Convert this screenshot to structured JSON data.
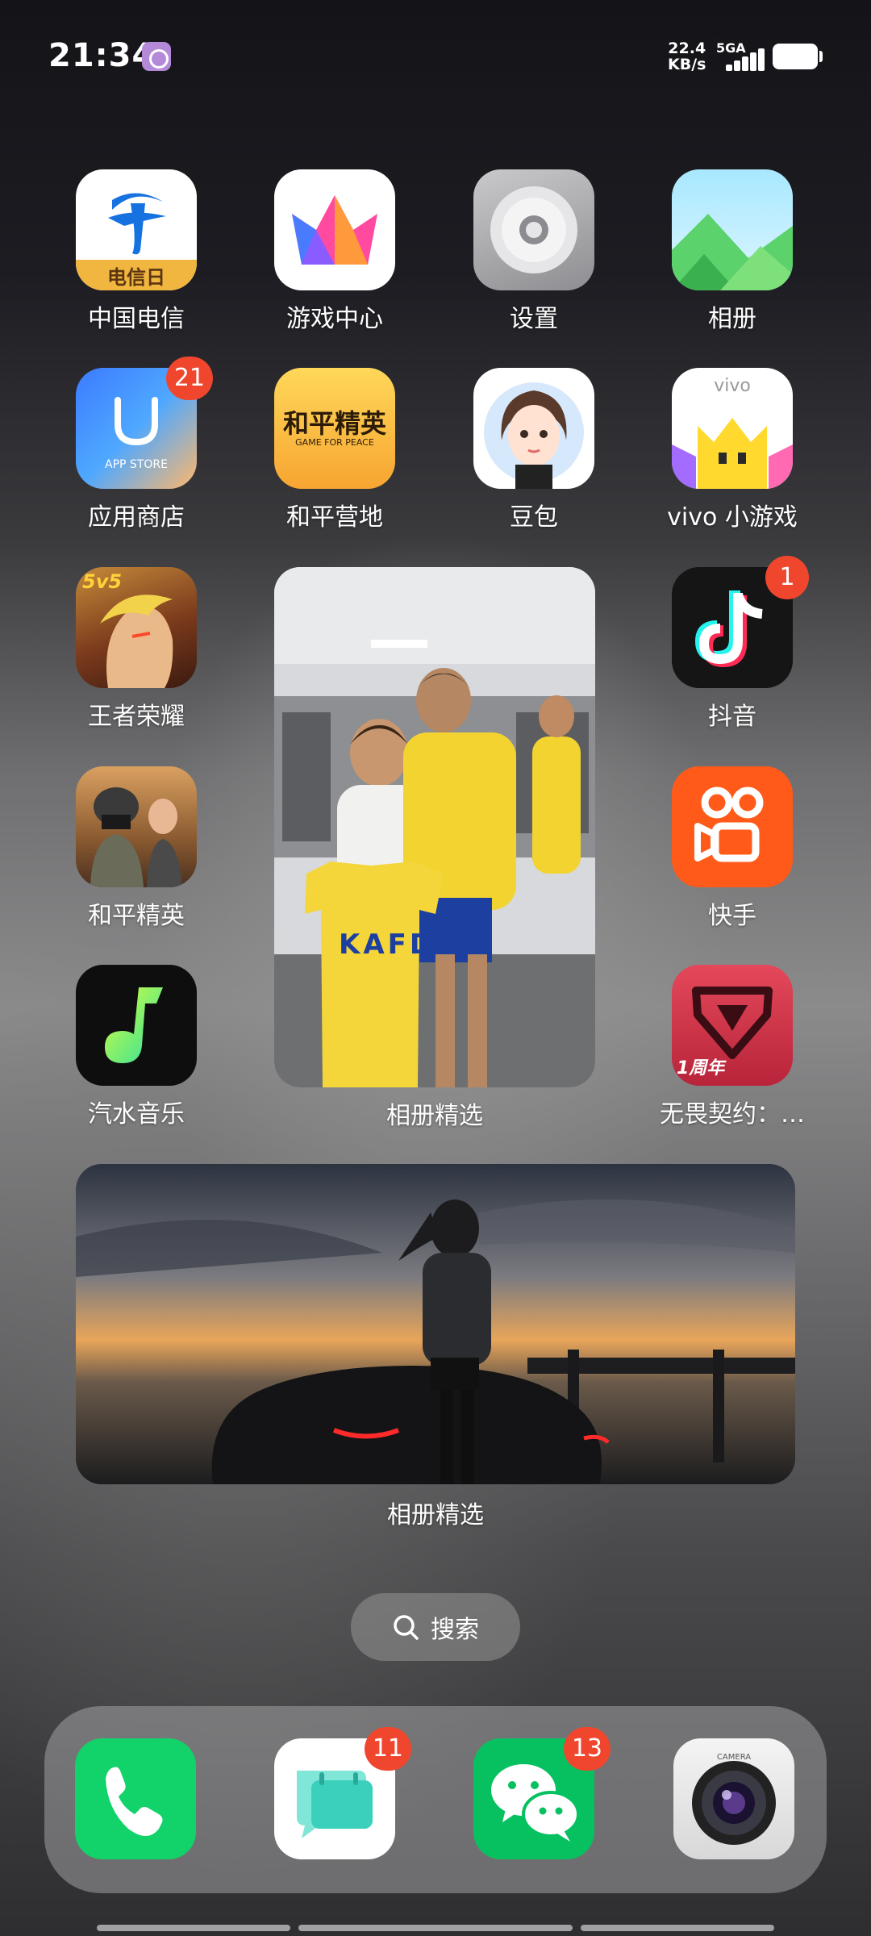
{
  "status_bar": {
    "time": "21:34",
    "net_speed_value": "22.4",
    "net_speed_unit": "KB/s",
    "net_type": "5GA"
  },
  "apps": {
    "china_telecom": {
      "label": "中国电信",
      "icon_text": "电信日"
    },
    "game_center": {
      "label": "游戏中心"
    },
    "settings": {
      "label": "设置"
    },
    "album": {
      "label": "相册"
    },
    "app_store": {
      "label": "应用商店",
      "icon_text": "APP STORE",
      "badge": "21"
    },
    "peace_camp": {
      "label": "和平营地",
      "icon_text": "和平精英",
      "icon_subtext": "GAME FOR PEACE"
    },
    "doubao": {
      "label": "豆包"
    },
    "vivo_games": {
      "label": "vivo 小游戏",
      "icon_text": "vivo"
    },
    "honor_of_kings": {
      "label": "王者荣耀",
      "icon_text": "5v5"
    },
    "douyin": {
      "label": "抖音",
      "badge": "1"
    },
    "peace_elite": {
      "label": "和平精英"
    },
    "kuaishou": {
      "label": "快手"
    },
    "qishui_music": {
      "label": "汽水音乐"
    },
    "valorant": {
      "label": "无畏契约：…",
      "icon_text": "1周年"
    }
  },
  "widgets": {
    "photo_top": {
      "label": "相册精选",
      "jersey_text": "KAFD"
    },
    "photo_bottom": {
      "label": "相册精选"
    }
  },
  "search": {
    "label": "搜索"
  },
  "dock": {
    "phone": {},
    "messages": {
      "badge": "11"
    },
    "wechat": {
      "badge": "13"
    },
    "camera": {
      "icon_text": "CAMERA"
    }
  },
  "colors": {
    "badge": "#f0462e",
    "douyin_bg": "#151515",
    "kuaishou_bg": "#ff5a1a",
    "wechat_green": "#07c160"
  }
}
